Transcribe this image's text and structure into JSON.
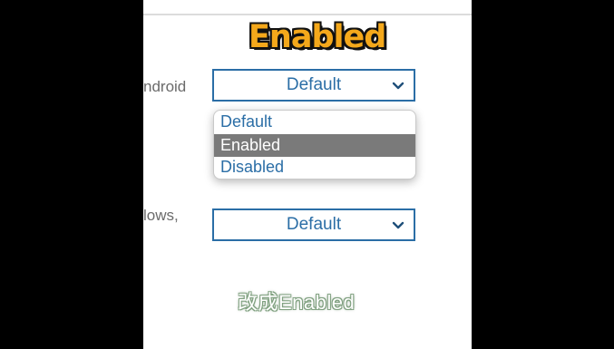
{
  "overlay_title": "Enabled",
  "rows": [
    {
      "label": "ndroid",
      "select_value": "Default"
    },
    {
      "label": "lows,",
      "select_value": "Default"
    }
  ],
  "dropdown": {
    "options": [
      "Default",
      "Enabled",
      "Disabled"
    ],
    "highlighted": "Enabled"
  },
  "caption": "改成Enabled",
  "colors": {
    "accent": "#2b6ea6",
    "highlight": "#7a7a7a",
    "title": "#f4a81b"
  },
  "icons": [
    "chevron-down-icon"
  ]
}
